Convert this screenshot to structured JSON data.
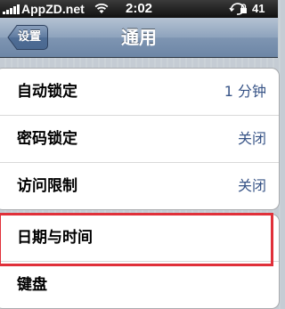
{
  "status_bar": {
    "carrier": "AppZD.net",
    "time": "2:02",
    "battery": "41 %",
    "icons": [
      "signal-icon",
      "wifi-icon",
      "rotation-lock-icon"
    ]
  },
  "nav": {
    "back_label": "设置",
    "title": "通用"
  },
  "group1": [
    {
      "label": "自动锁定",
      "value": "1 分钟"
    },
    {
      "label": "密码锁定",
      "value": "关闭"
    },
    {
      "label": "访问限制",
      "value": "关闭"
    }
  ],
  "group2": [
    {
      "label": "日期与时间"
    },
    {
      "label": "键盘"
    }
  ],
  "colors": {
    "nav_bar": "#6d86a6",
    "value_text": "#385487",
    "highlight": "#e0303a",
    "background": "#c5ccd4"
  }
}
